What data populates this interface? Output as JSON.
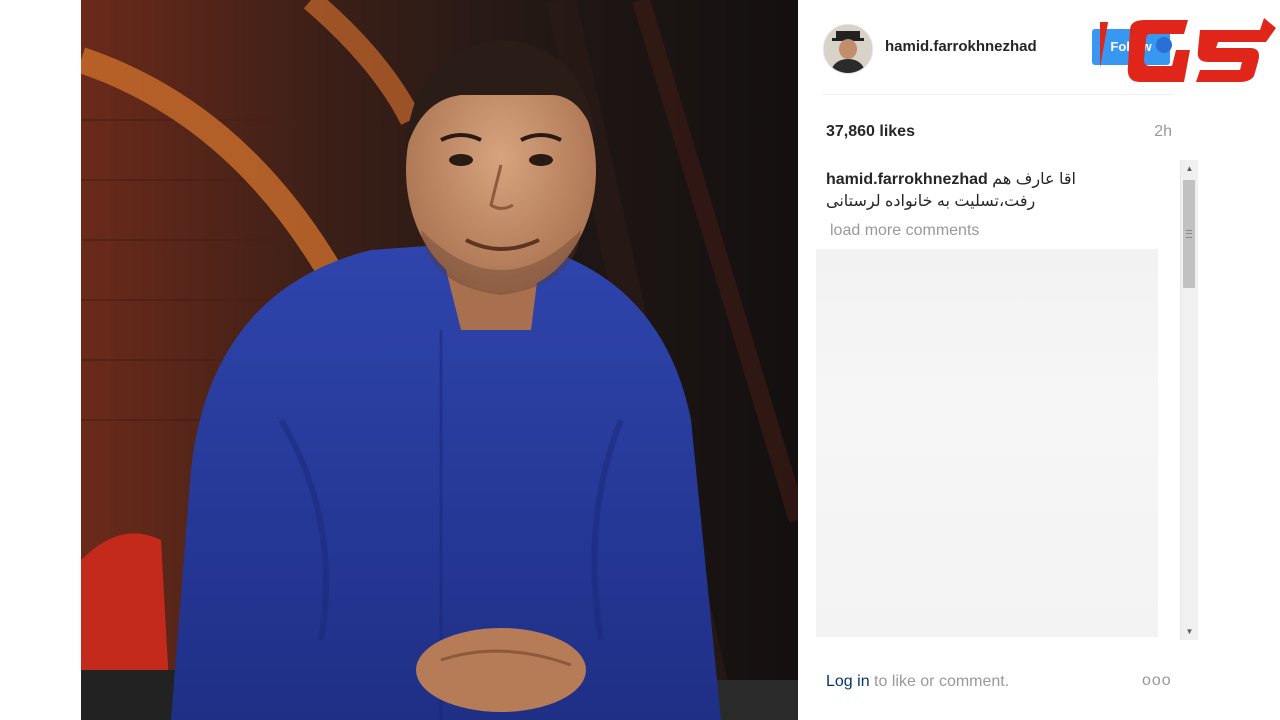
{
  "post": {
    "username": "hamid.farrokhnezhad",
    "follow_label": "Follow",
    "likes": "37,860 likes",
    "time": "2h",
    "caption": {
      "user": "hamid.farrokhnezhad",
      "line1": "اقا عارف هم",
      "line2": "رفت،تسلیت به خانواده لرستانی"
    },
    "load_more": "load more comments",
    "footer": {
      "login": "Log in",
      "rest": " to like or comment.",
      "more": "ooo"
    }
  },
  "icons": [
    "avatar-image",
    "scroll-up-arrow-icon",
    "scroll-down-arrow-icon",
    "more-options-icon"
  ],
  "colors": {
    "follow_button": "#3897f0",
    "login_link": "#003569",
    "logo_red": "#e0251b",
    "shirt_blue": "#2a3ea0"
  }
}
